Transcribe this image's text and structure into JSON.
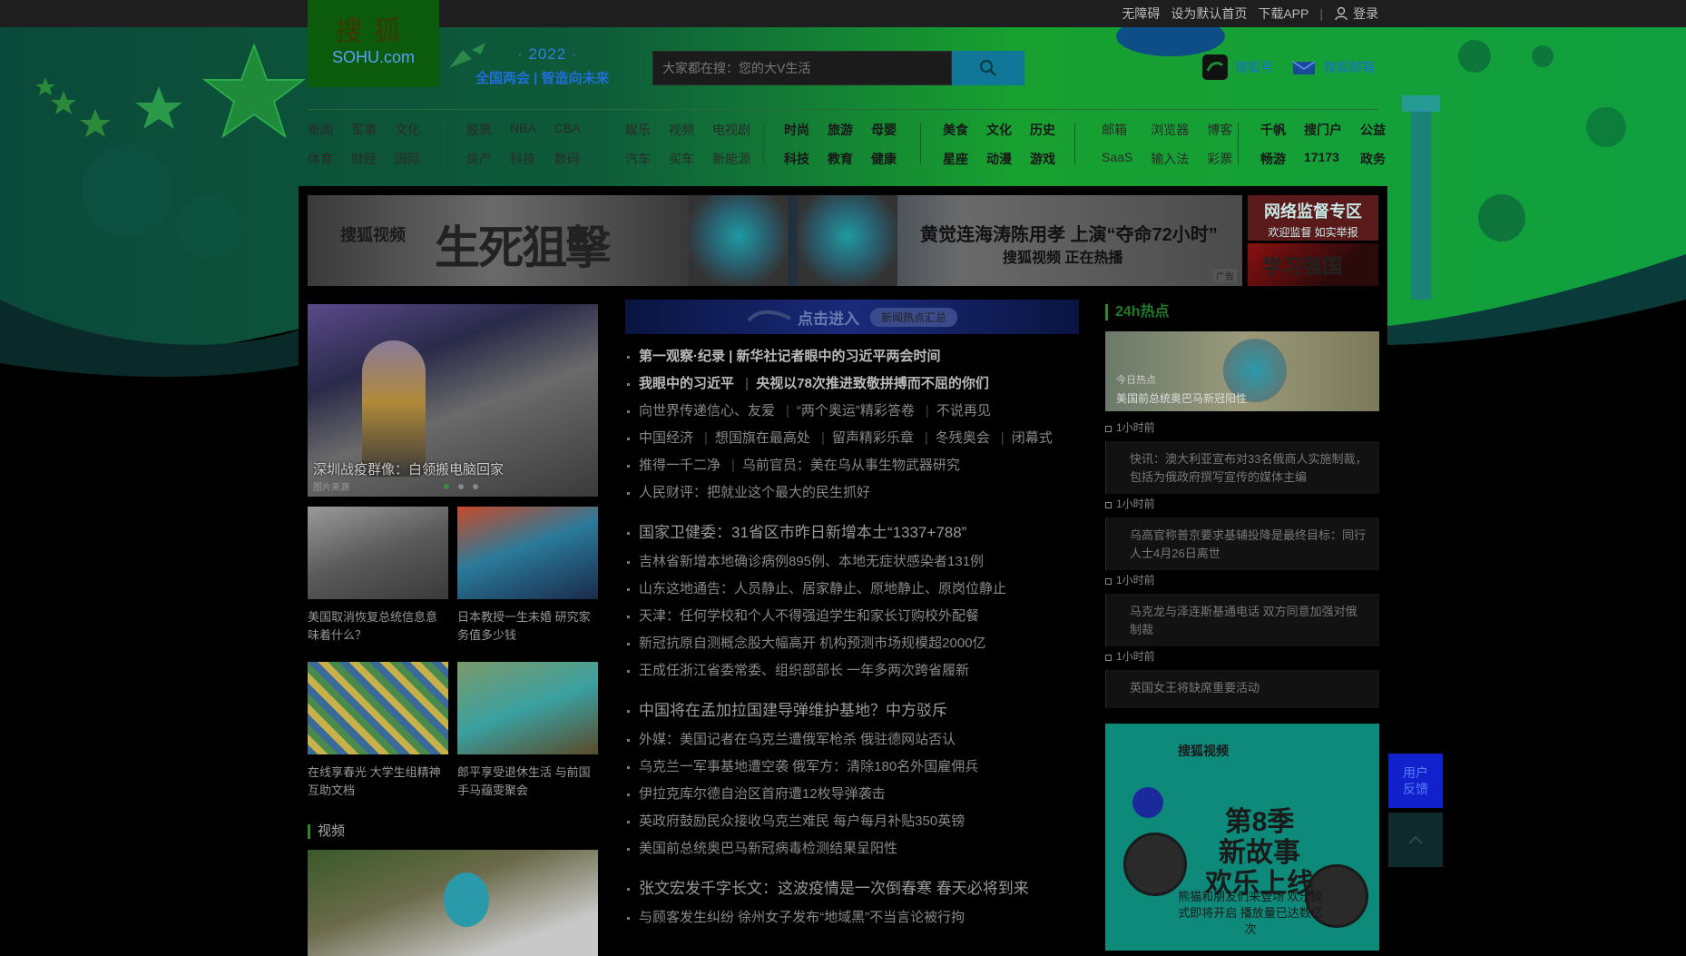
{
  "topbar": {
    "links": [
      "无障碍",
      "设为默认首页",
      "下载APP"
    ],
    "login": "登录"
  },
  "logo": {
    "cn": "搜狐",
    "en": "SOHU.com"
  },
  "campaign": {
    "year": "· 2022 ·",
    "title": "全国两会 | 智造向未来"
  },
  "search": {
    "placeholder": "大家都在搜：您的大V生活"
  },
  "header_links": [
    "搜狐号",
    "搜狐邮箱"
  ],
  "nav": {
    "groups": [
      {
        "items": [
          "新闻",
          "军事",
          "文化",
          "体育",
          "财经",
          "国际"
        ],
        "bold": false
      },
      {
        "items": [
          "股票",
          "NBA",
          "CBA",
          "房产",
          "科技",
          "数码"
        ],
        "bold": false
      },
      {
        "items": [
          "娱乐",
          "视频",
          "电视剧",
          "汽车",
          "买车",
          "新能源"
        ],
        "bold": false
      },
      {
        "items": [
          "时尚",
          "旅游",
          "母婴",
          "科技",
          "教育",
          "健康"
        ],
        "bold": true
      },
      {
        "items": [
          "美食",
          "文化",
          "历史",
          "星座",
          "动漫",
          "游戏"
        ],
        "bold": true
      },
      {
        "items": [
          "邮箱",
          "浏览器",
          "博客",
          "SaaS",
          "输入法",
          "彩票"
        ],
        "bold": false
      },
      {
        "items": [
          "千帆",
          "搜门户",
          "公益",
          "畅游",
          "17173",
          "政务"
        ],
        "bold": true
      }
    ]
  },
  "banner": {
    "brand": "搜狐视频",
    "title": "生死狙擊",
    "caption1": "黄觉连海涛陈用孝 上演“夺命72小时”",
    "caption2": "搜狐视频 正在热播",
    "tag": "广告"
  },
  "side_ads": {
    "ad1_title": "网络监督专区",
    "ad1_sub": "欢迎监督 如实举报",
    "ad2_title": "学习强国"
  },
  "left": {
    "hero_caption": "深圳战疫群像：白领搬电脑回家",
    "hero_source": "图片来源",
    "thumbs": [
      "美国取消恢复总统信息意味着什么？",
      "日本教授一生未婚 研究家务值多少钱",
      "在线享春光 大学生组精神互助文档",
      "郎平享受退休生活 与前国手马蕴雯聚会"
    ],
    "video_title": "视频"
  },
  "center": {
    "banner_title": "点击进入",
    "banner_pill": "新闻热点汇总",
    "groups": [
      [
        {
          "parts": [
            "第一观察·纪录 | 新华社记者眼中的习近平两会时间"
          ],
          "style": "bold"
        },
        {
          "parts": [
            "我眼中的习近平",
            "央视以78次推进致敬拼搏而不屈的你们"
          ],
          "style": "bold"
        },
        {
          "parts": [
            "向世界传递信心、友爱",
            "“两个奥运”精彩答卷",
            "不说再见"
          ],
          "style": ""
        },
        {
          "parts": [
            "中国经济",
            "想国旗在最高处",
            "留声精彩乐章",
            "冬残奥会",
            "闭幕式"
          ],
          "style": ""
        },
        {
          "parts": [
            "推得一千二净",
            "乌前官员：美在乌从事生物武器研究"
          ],
          "style": ""
        },
        {
          "parts": [
            "人民财评：把就业这个最大的民生抓好"
          ],
          "style": ""
        }
      ],
      [
        {
          "parts": [
            "国家卫健委：31省区市昨日新增本土“1337+788”"
          ],
          "style": "big"
        },
        {
          "parts": [
            "吉林省新增本地确诊病例895例、本地无症状感染者131例"
          ],
          "style": ""
        },
        {
          "parts": [
            "山东这地通告：人员静止、居家静止、原地静止、原岗位静止"
          ],
          "style": ""
        },
        {
          "parts": [
            "天津：任何学校和个人不得强迫学生和家长订购校外配餐"
          ],
          "style": ""
        },
        {
          "parts": [
            "新冠抗原自测概念股大幅高开 机构预测市场规模超2000亿"
          ],
          "style": ""
        },
        {
          "parts": [
            "王成任浙江省委常委、组织部部长 一年多两次跨省履新"
          ],
          "style": ""
        }
      ],
      [
        {
          "parts": [
            "中国将在孟加拉国建导弹维护基地？中方驳斥"
          ],
          "style": "big"
        },
        {
          "parts": [
            "外媒：美国记者在乌克兰遭俄军枪杀 俄驻德网站否认"
          ],
          "style": ""
        },
        {
          "parts": [
            "乌克兰一军事基地遭空袭 俄军方：清除180名外国雇佣兵"
          ],
          "style": ""
        },
        {
          "parts": [
            "伊拉克库尔德自治区首府遭12枚导弹袭击"
          ],
          "style": ""
        },
        {
          "parts": [
            "英政府鼓励民众接收乌克兰难民 每户每月补贴350英镑"
          ],
          "style": ""
        },
        {
          "parts": [
            "美国前总统奥巴马新冠病毒检测结果呈阳性"
          ],
          "style": ""
        }
      ],
      [
        {
          "parts": [
            "张文宏发千字长文：这波疫情是一次倒春寒 春天必将到来"
          ],
          "style": "big"
        },
        {
          "parts": [
            "与顾客发生纠纷 徐州女子发布“地域黑”不当言论被行拘"
          ],
          "style": ""
        }
      ]
    ]
  },
  "right": {
    "title": "24h热点",
    "hero_label": "今日热点",
    "hero_caption": "美国前总统奥巴马新冠阳性",
    "timeline": [
      {
        "time": "1小时前",
        "text": "快讯：澳大利亚宣布对33名俄商人实施制裁，包括为俄政府撰写宣传的媒体主编"
      },
      {
        "time": "1小时前",
        "text": "乌高官称普京要求基辅投降是最终目标：同行人士4月26日离世"
      },
      {
        "time": "1小时前",
        "text": "马克龙与泽连斯基通电话 双方同意加强对俄制裁"
      },
      {
        "time": "1小时前",
        "text": "英国女王将缺席重要活动"
      }
    ],
    "ad_brand": "搜狐视频",
    "ad_title": "第8季\n新故事\n欢乐上线",
    "ad_sub": "熊猫和朋友们来登场 欢乐模式即将开启 播放量已达数亿次"
  },
  "float": {
    "feedback": "用户反馈"
  }
}
